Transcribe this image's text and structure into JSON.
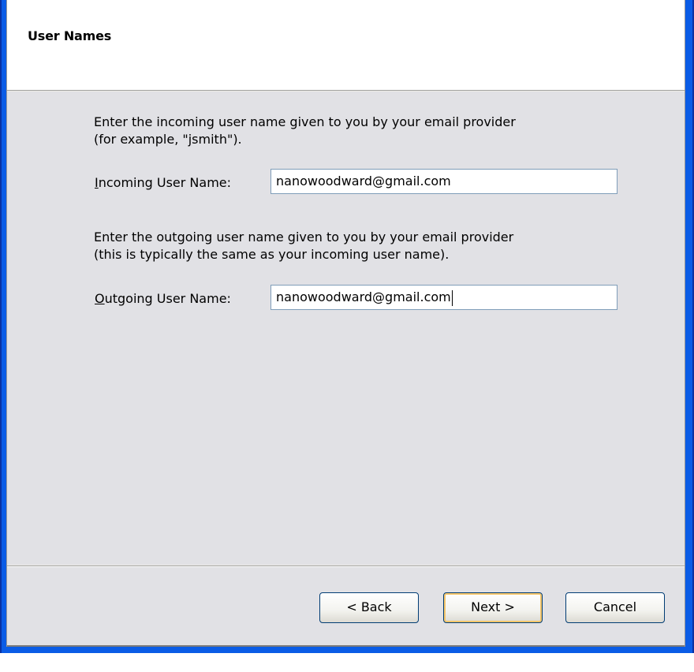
{
  "window": {
    "close_glyph": "✕"
  },
  "header": {
    "title": "User Names"
  },
  "incoming": {
    "description_line1": "Enter the incoming user name given to you by your email provider",
    "description_line2": "(for example, \"jsmith\").",
    "label_mnemonic": "I",
    "label_rest": "ncoming User Name:",
    "value": "nanowoodward@gmail.com"
  },
  "outgoing": {
    "description_line1": "Enter the outgoing user name given to you by your email provider",
    "description_line2": "(this is typically the same as your incoming user name).",
    "label_mnemonic": "O",
    "label_rest": "utgoing User Name:",
    "value": "nanowoodward@gmail.com"
  },
  "buttons": {
    "back": "< Back",
    "next": "Next >",
    "cancel": "Cancel"
  },
  "colors": {
    "window_frame": "#0a5ce6",
    "dialog_background": "#e1e1e5",
    "header_background": "#ffffff",
    "default_button_highlight": "#f5c66b"
  }
}
